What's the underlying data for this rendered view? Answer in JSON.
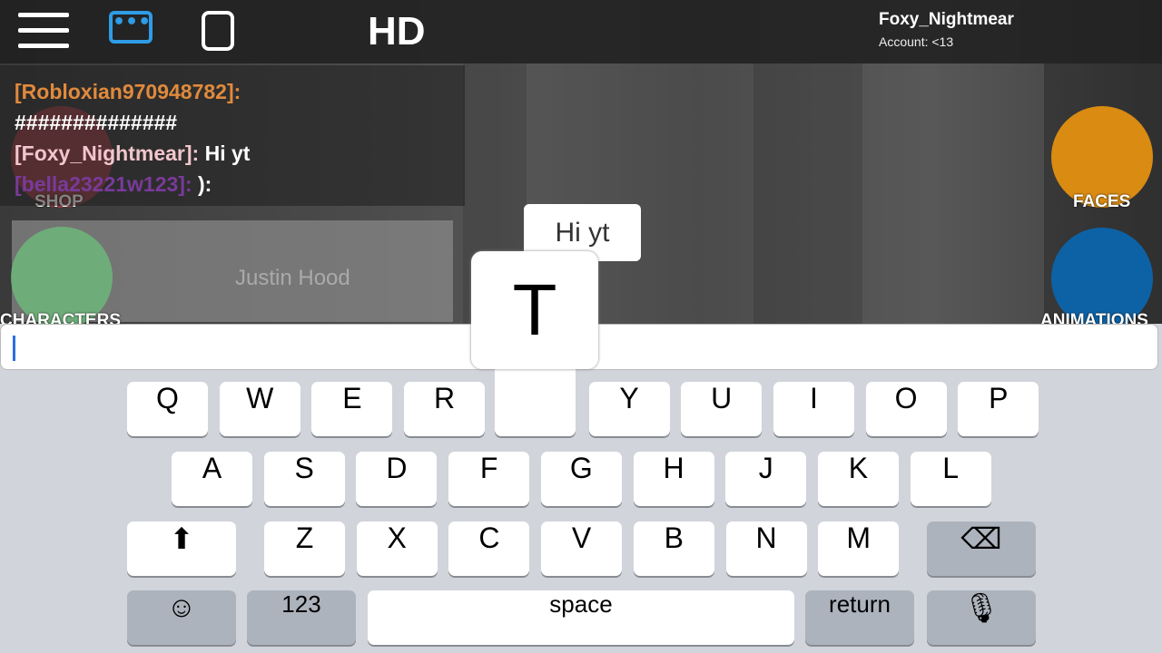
{
  "topbar": {
    "hd_label": "HD",
    "username": "Foxy_Nightmear",
    "account": "Account: <13",
    "chat_icon": "chat-bubble-icon",
    "menu_icon": "hamburger-menu-icon",
    "backpack_icon": "backpack-icon"
  },
  "chat": {
    "messages": [
      {
        "name": "[Robloxian970948782]:",
        "text": "",
        "color": "#e08a3c"
      },
      {
        "name": "",
        "text": "##############",
        "color": "#ffffff"
      },
      {
        "name": "[Foxy_Nightmear]:",
        "text": " Hi yt",
        "color": "#f2c6cc"
      },
      {
        "name": "[bella23221w123]:",
        "text": "  ):",
        "color": "#7a3a9a"
      }
    ]
  },
  "game": {
    "nametag": "Justin Hood",
    "bubble": "Hi yt",
    "left_buttons": [
      {
        "label": "SHOP",
        "color": "#c0464e"
      },
      {
        "label": "CHARACTERS",
        "color": "#6dbb7a"
      }
    ],
    "right_buttons": [
      {
        "label": "FACES",
        "color": "#d98b12"
      },
      {
        "label": "ANIMATIONS",
        "color": "#0d62a6"
      }
    ]
  },
  "input": {
    "value": ""
  },
  "keyboard": {
    "popup_key": "T",
    "row1": [
      "Q",
      "W",
      "E",
      "R",
      "",
      "Y",
      "U",
      "I",
      "O",
      "P"
    ],
    "row2": [
      "A",
      "S",
      "D",
      "F",
      "G",
      "H",
      "J",
      "K",
      "L"
    ],
    "row3": [
      "Z",
      "X",
      "C",
      "V",
      "B",
      "N",
      "M"
    ],
    "shift_icon": "shift-arrow-icon",
    "backspace_icon": "backspace-icon",
    "emoji_icon": "emoji-icon",
    "numbers": "123",
    "space": "space",
    "return": "return",
    "mic_icon": "microphone-icon"
  }
}
